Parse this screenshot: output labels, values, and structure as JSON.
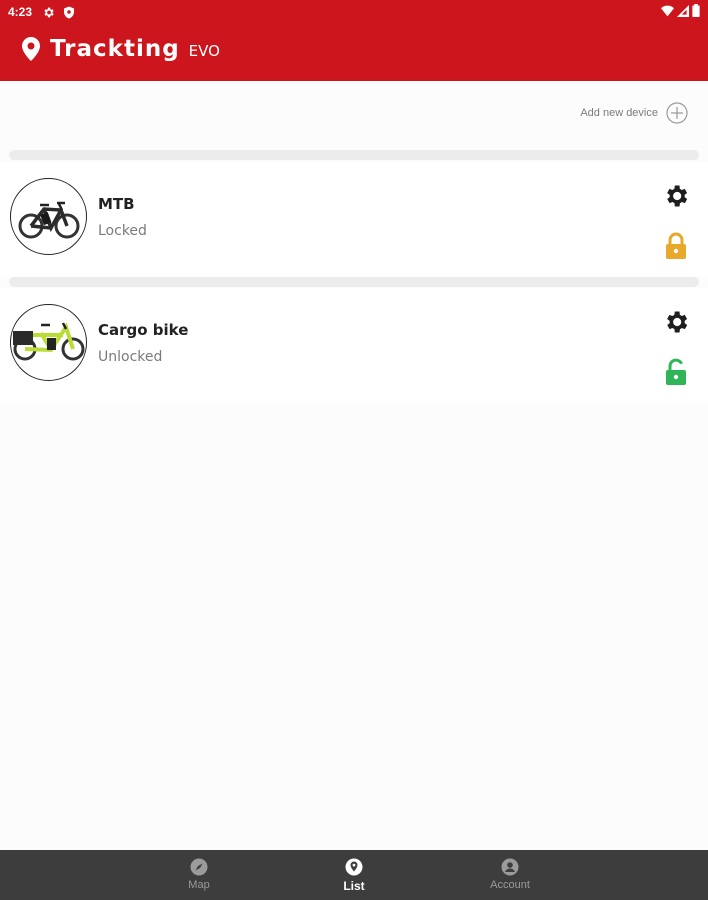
{
  "status_bar": {
    "time": "4:23"
  },
  "app": {
    "title": "Trackting",
    "subtitle": "EVO",
    "accent": "#cc151d"
  },
  "actions": {
    "add_device_label": "Add new device"
  },
  "devices": [
    {
      "name": "MTB",
      "status": "Locked",
      "lock_icon": "lock-closed-icon",
      "lock_color": "#e8a92b"
    },
    {
      "name": "Cargo bike",
      "status": "Unlocked",
      "lock_icon": "lock-open-icon",
      "lock_color": "#2fb457"
    }
  ],
  "nav": {
    "items": [
      {
        "label": "Map",
        "icon": "compass-icon"
      },
      {
        "label": "List",
        "icon": "location-pin-icon",
        "active": true
      },
      {
        "label": "Account",
        "icon": "user-icon"
      }
    ]
  }
}
